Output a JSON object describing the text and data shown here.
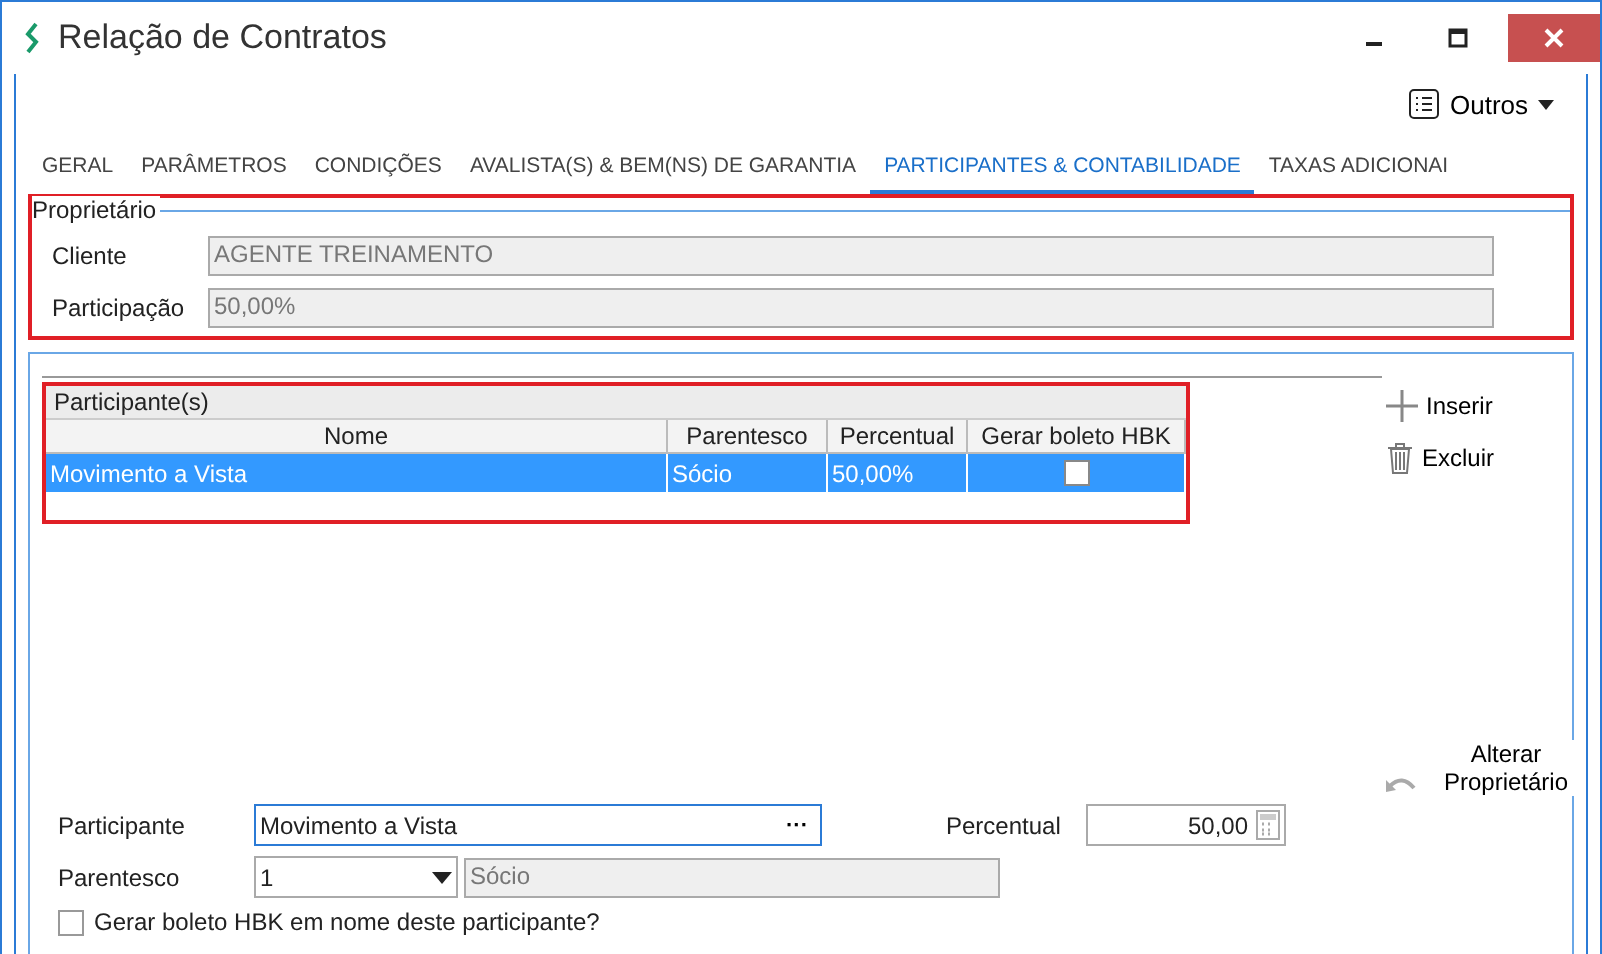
{
  "window": {
    "title": "Relação de Contratos"
  },
  "toolbar": {
    "outros": "Outros"
  },
  "tabs": [
    {
      "label": "GERAL",
      "selected": false
    },
    {
      "label": "PARÂMETROS",
      "selected": false
    },
    {
      "label": "CONDIÇÕES",
      "selected": false
    },
    {
      "label": "AVALISTA(S) & BEM(NS) DE GARANTIA",
      "selected": false
    },
    {
      "label": "PARTICIPANTES & CONTABILIDADE",
      "selected": true
    },
    {
      "label": "TAXAS ADICIONAI",
      "selected": false
    }
  ],
  "owner": {
    "legend": "Proprietário",
    "fields": [
      {
        "label": "Cliente",
        "value": "AGENTE TREINAMENTO"
      },
      {
        "label": "Participação",
        "value": "50,00%"
      }
    ]
  },
  "participants": {
    "title": "Participante(s)",
    "columns": [
      "Nome",
      "Parentesco",
      "Percentual",
      "Gerar boleto HBK"
    ],
    "rows": [
      {
        "nome": "Movimento a Vista",
        "parentesco": "Sócio",
        "percentual": "50,00%",
        "gerar_boleto": false,
        "selected": true
      }
    ]
  },
  "actions": [
    {
      "kind": "add",
      "label": "Inserir"
    },
    {
      "kind": "delete",
      "label": "Excluir"
    }
  ],
  "change_owner": {
    "label": "Alterar Proprietário"
  },
  "form": {
    "participante_label": "Participante",
    "participante_value": "Movimento a Vista",
    "ellipsis": "···",
    "percentual_label": "Percentual",
    "percentual_value": "50,00",
    "parentesco_label": "Parentesco",
    "parentesco_code": "1",
    "parentesco_name": "Sócio",
    "checkbox_label": "Gerar boleto HBK em nome deste participante?",
    "checkbox_checked": false
  }
}
